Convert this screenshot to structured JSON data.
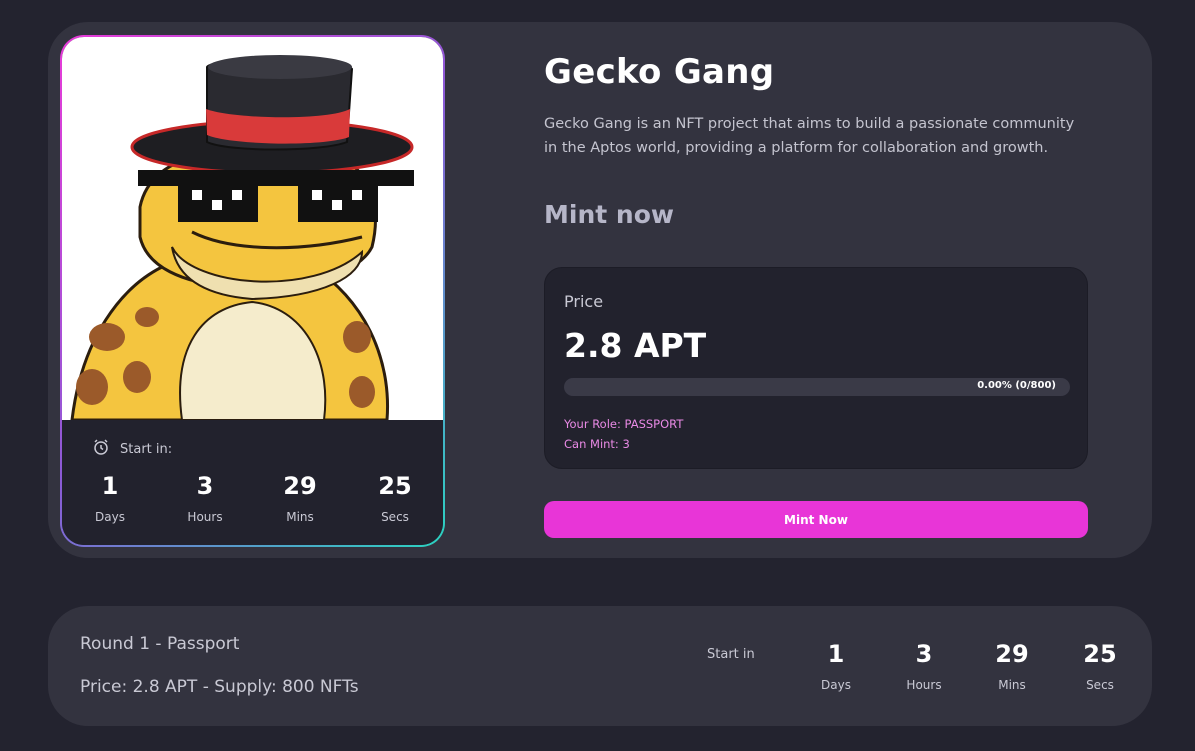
{
  "collection": {
    "title": "Gecko Gang",
    "description": "Gecko Gang is an NFT project that aims to build a passionate community in the Aptos world, providing a platform for collaboration and growth.",
    "mint_heading": "Mint now"
  },
  "nft_card": {
    "start_in_label": "Start in:",
    "icon": "alarm-clock-icon",
    "countdown": [
      {
        "value": "1",
        "unit": "Days"
      },
      {
        "value": "3",
        "unit": "Hours"
      },
      {
        "value": "29",
        "unit": "Mins"
      },
      {
        "value": "25",
        "unit": "Secs"
      }
    ]
  },
  "price_box": {
    "label": "Price",
    "value": "2.8 APT",
    "progress_text": "0.00% (0/800)",
    "progress_fraction": 0.0,
    "role_line": "Your Role: PASSPORT",
    "can_mint_line": "Can Mint: 3"
  },
  "mint_button": {
    "label": "Mint Now"
  },
  "round": {
    "title": "Round 1 - Passport",
    "meta": "Price: 2.8 APT - Supply: 800 NFTs",
    "start_in_label": "Start in",
    "countdown": [
      {
        "value": "1",
        "unit": "Days"
      },
      {
        "value": "3",
        "unit": "Hours"
      },
      {
        "value": "29",
        "unit": "Mins"
      },
      {
        "value": "25",
        "unit": "Secs"
      }
    ]
  },
  "colors": {
    "background": "#23232f",
    "card": "#33333f",
    "accent": "#e835d7",
    "role_text": "#e98ae5"
  }
}
